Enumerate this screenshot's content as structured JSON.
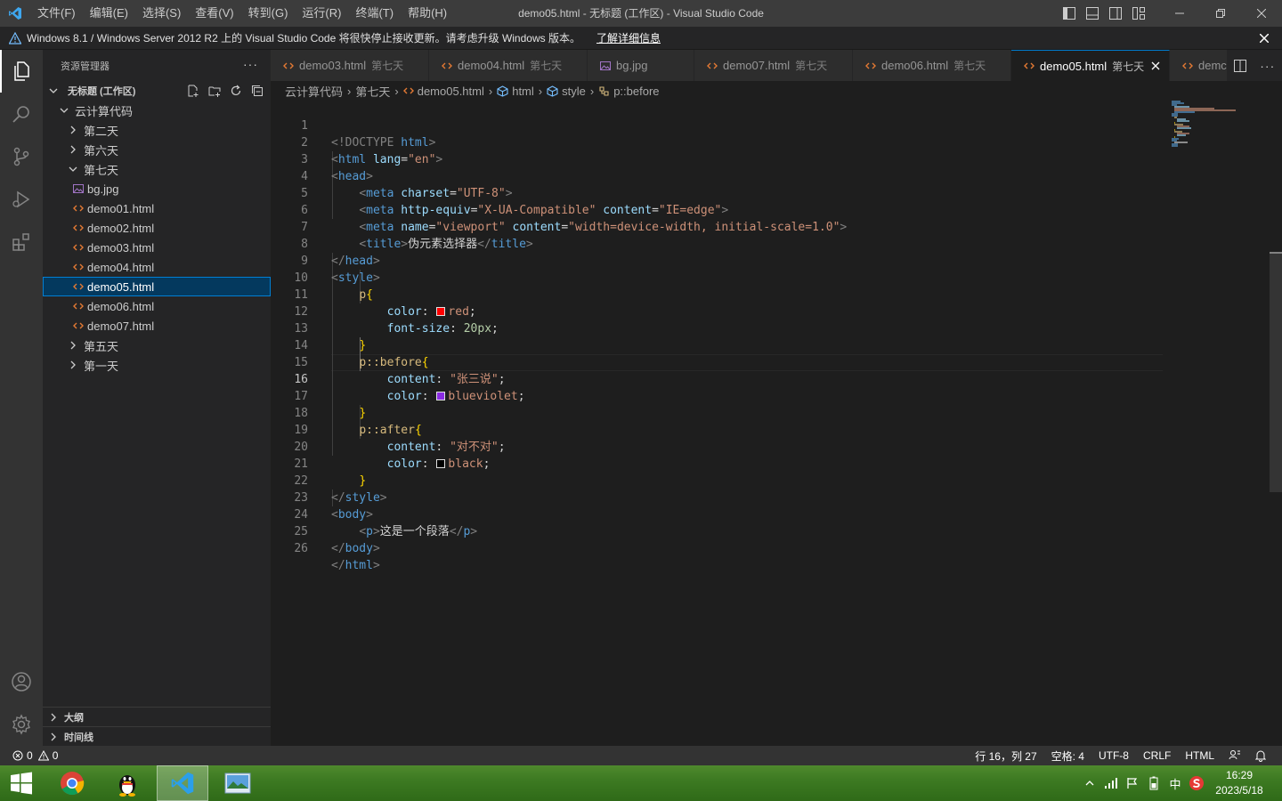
{
  "titlebar": {
    "menus": [
      "文件(F)",
      "编辑(E)",
      "选择(S)",
      "查看(V)",
      "转到(G)",
      "运行(R)",
      "终端(T)",
      "帮助(H)"
    ],
    "title": "demo05.html - 无标题 (工作区) - Visual Studio Code"
  },
  "banner": {
    "text": "Windows 8.1 / Windows Server 2012 R2 上的 Visual Studio Code 将很快停止接收更新。请考虑升级 Windows 版本。",
    "link": "了解详细信息"
  },
  "sidebar": {
    "title": "资源管理器",
    "more": "···",
    "workspace": "无标题 (工作区)",
    "tree": [
      {
        "label": "云计算代码",
        "type": "folder-open"
      },
      {
        "label": "第二天",
        "type": "folder"
      },
      {
        "label": "第六天",
        "type": "folder"
      },
      {
        "label": "第七天",
        "type": "folder-open"
      },
      {
        "label": "bg.jpg",
        "type": "image"
      },
      {
        "label": "demo01.html",
        "type": "html"
      },
      {
        "label": "demo02.html",
        "type": "html"
      },
      {
        "label": "demo03.html",
        "type": "html"
      },
      {
        "label": "demo04.html",
        "type": "html"
      },
      {
        "label": "demo05.html",
        "type": "html"
      },
      {
        "label": "demo06.html",
        "type": "html"
      },
      {
        "label": "demo07.html",
        "type": "html"
      },
      {
        "label": "第五天",
        "type": "folder"
      },
      {
        "label": "第一天",
        "type": "folder"
      }
    ],
    "outline": "大纲",
    "timeline": "时间线"
  },
  "tabs": [
    {
      "name": "demo03.html",
      "desc": "第七天",
      "type": "html"
    },
    {
      "name": "demo04.html",
      "desc": "第七天",
      "type": "html"
    },
    {
      "name": "bg.jpg",
      "desc": "",
      "type": "image"
    },
    {
      "name": "demo07.html",
      "desc": "第七天",
      "type": "html"
    },
    {
      "name": "demo06.html",
      "desc": "第七天",
      "type": "html"
    },
    {
      "name": "demo05.html",
      "desc": "第七天",
      "type": "html"
    },
    {
      "name": "demc",
      "desc": "",
      "type": "html"
    }
  ],
  "breadcrumb": [
    "云计算代码",
    "第七天",
    "demo05.html",
    "html",
    "style",
    "p::before"
  ],
  "editor": {
    "line_numbers": [
      "1",
      "2",
      "3",
      "4",
      "5",
      "6",
      "7",
      "8",
      "9",
      "10",
      "11",
      "12",
      "13",
      "14",
      "15",
      "16",
      "17",
      "18",
      "19",
      "20",
      "21",
      "22",
      "23",
      "24",
      "25",
      "26"
    ],
    "current_line": 16,
    "code": {
      "l1a": "<!DOCTYPE ",
      "l1b": "html",
      "l1c": ">",
      "l2_tag": "html",
      "l2_attr": "lang",
      "l2_val": "\"en\"",
      "l3_tag": "head",
      "l4_tag": "meta",
      "l4_attr": "charset",
      "l4_val": "\"UTF-8\"",
      "l5_tag": "meta",
      "l5_attr1": "http-equiv",
      "l5_val1": "\"X-UA-Compatible\"",
      "l5_attr2": "content",
      "l5_val2": "\"IE=edge\"",
      "l6_tag": "meta",
      "l6_attr1": "name",
      "l6_val1": "\"viewport\"",
      "l6_attr2": "content",
      "l6_val2": "\"width=device-width, initial-scale=1.0\"",
      "l7_tag": "title",
      "l7_text": "伪元素选择器",
      "l8_tag": "head",
      "l9_tag": "style",
      "l10_sel": "p",
      "l11_prop": "color",
      "l11_val": "red",
      "l12_prop": "font-size",
      "l12_val": "20px",
      "l14_sel": "p::before",
      "l15_prop": "content",
      "l15_val": "\"张三说\"",
      "l16_prop": "color",
      "l16_val": "blueviolet",
      "l18_sel": "p::after",
      "l19_prop": "content",
      "l19_val": "\"对不对\"",
      "l20_prop": "color",
      "l20_val": "black",
      "l22_tag": "style",
      "l23_tag": "body",
      "l24_tag": "p",
      "l24_text": "这是一个段落",
      "l25_tag": "body",
      "l26_tag": "html"
    },
    "swatch_colors": {
      "red": "#ff0000",
      "blueviolet": "#8a2be2",
      "black": "#000000"
    }
  },
  "statusbar": {
    "errors": "0",
    "warnings": "0",
    "position": "行 16，列 27",
    "spaces": "空格: 4",
    "encoding": "UTF-8",
    "eol": "CRLF",
    "language": "HTML"
  },
  "taskbar": {
    "apps": [
      "chrome-icon",
      "qq-icon",
      "vscode-icon",
      "image-viewer-icon"
    ],
    "ime": "中",
    "time": "16:29",
    "date": "2023/5/18"
  },
  "colors": {
    "accent": "#007acc",
    "titlebar": "#3c3c3c",
    "statusbar": "#333333",
    "editor_bg": "#1e1e1e",
    "sidebar_bg": "#252526"
  }
}
